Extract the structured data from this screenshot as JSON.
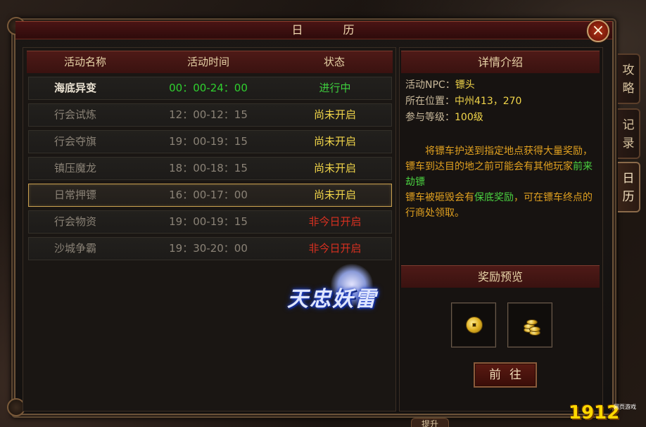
{
  "window": {
    "title": "日 历",
    "close_symbol": "×"
  },
  "list": {
    "headers": [
      "活动名称",
      "活动时间",
      "状态"
    ],
    "rows": [
      {
        "name": "海底异变",
        "time": "00：00-24：00",
        "status": "进行中",
        "state": "active"
      },
      {
        "name": "行会试炼",
        "time": "12：00-12：15",
        "status": "尚未开启",
        "state": "pending"
      },
      {
        "name": "行会夺旗",
        "time": "19：00-19：15",
        "status": "尚未开启",
        "state": "pending"
      },
      {
        "name": "镇压魔龙",
        "time": "18：00-18：15",
        "status": "尚未开启",
        "state": "pending"
      },
      {
        "name": "日常押镖",
        "time": "16：00-17：00",
        "status": "尚未开启",
        "state": "pending",
        "selected": true
      },
      {
        "name": "行会物资",
        "time": "19：00-19：15",
        "status": "非今日开启",
        "state": "notoday"
      },
      {
        "name": "沙城争霸",
        "time": "19：30-20：00",
        "status": "非今日开启",
        "state": "notoday"
      }
    ]
  },
  "logo": {
    "text": "天忠妖雷"
  },
  "detail": {
    "header": "详情介绍",
    "npc_label": "活动NPC：",
    "npc_value": "镖头",
    "location_label": "所在位置：",
    "location_value": "中州413，270",
    "level_label": "参与等级：",
    "level_value": "100级",
    "desc_1": "将镖车护送到指定地点获得大量奖励，镖车到达目的地之前可能会有其他玩家",
    "desc_hl_1": "前来劫镖",
    "desc_2": "镖车被砸毁会有",
    "desc_hl_2": "保底奖励",
    "desc_3": "，可在镖车终点的行商处领取。"
  },
  "reward": {
    "header": "奖励预览",
    "items": [
      "coin-icon",
      "gold-stack-icon"
    ]
  },
  "go_button": "前往",
  "side_tabs": [
    {
      "label": "攻略",
      "active": false
    },
    {
      "label": "记录",
      "active": false
    },
    {
      "label": "日历",
      "active": true
    }
  ],
  "bottom_hint": "提升",
  "watermark": {
    "main": "1912",
    "sub": "网页游戏"
  },
  "colors": {
    "active_status": "#3ecf3e",
    "pending_status": "#f2d64a",
    "notoday_status": "#d83020",
    "active_name": "#ece4d4",
    "inactive_text": "#8a8276",
    "time_active": "#2fd02f"
  }
}
